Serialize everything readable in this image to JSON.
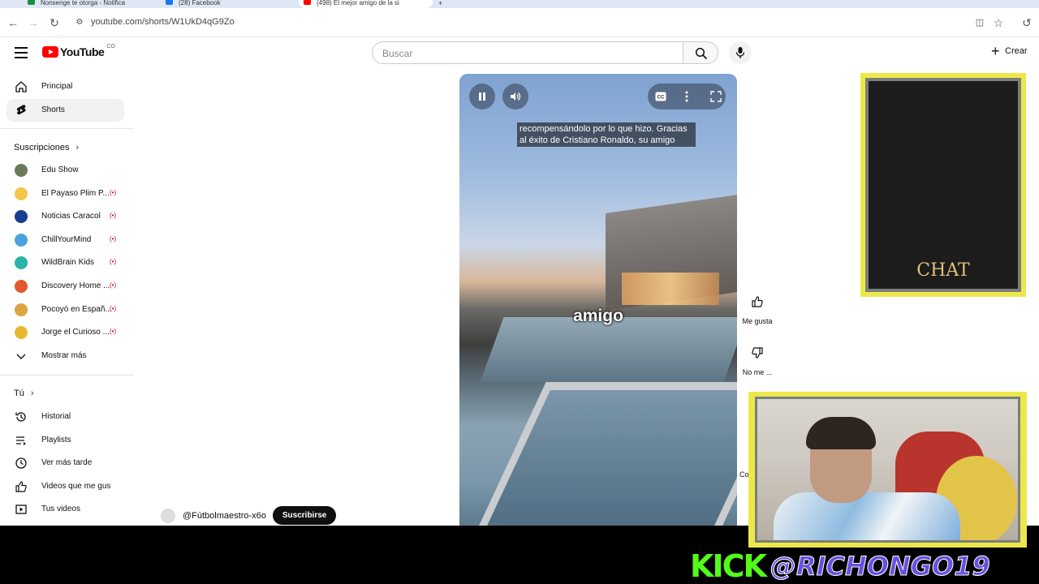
{
  "browser": {
    "tabs": [
      {
        "title": "Nonsenge te otorga - Notifica",
        "favicon_color": "#1e8e3e"
      },
      {
        "title": "(28) Facebook",
        "favicon_color": "#1877f2"
      },
      {
        "title": "(498) El mejor amigo de la si",
        "favicon_color": "#ff0000"
      }
    ],
    "url": "youtube.com/shorts/W1UkD4qG9Zo"
  },
  "header": {
    "logo_text": "YouTube",
    "country_code": "CO",
    "search_placeholder": "Buscar",
    "create_label": "Crear"
  },
  "sidebar": {
    "main": [
      {
        "label": "Principal",
        "icon": "home-icon"
      },
      {
        "label": "Shorts",
        "icon": "shorts-icon"
      }
    ],
    "subscriptions_title": "Suscripciones",
    "subscriptions": [
      {
        "label": "Edu Show",
        "color": "#6b7a5a",
        "live": false
      },
      {
        "label": "El Payaso Plim P...",
        "color": "#f3c64a",
        "live": true
      },
      {
        "label": "Noticias Caracol",
        "color": "#1a3d8f",
        "live": true
      },
      {
        "label": "ChillYourMind",
        "color": "#4aa3df",
        "live": true
      },
      {
        "label": "WildBrain Kids",
        "color": "#2bb3a8",
        "live": true
      },
      {
        "label": "Discovery Home ...",
        "color": "#e2572c",
        "live": true
      },
      {
        "label": "Pocoyó en Españ...",
        "color": "#d9a441",
        "live": true
      },
      {
        "label": "Jorge el Curioso ...",
        "color": "#e8b92e",
        "live": true
      }
    ],
    "show_more": "Mostrar más",
    "you_title": "Tú",
    "you_items": [
      {
        "label": "Historial",
        "icon": "history-icon"
      },
      {
        "label": "Playlists",
        "icon": "playlists-icon"
      },
      {
        "label": "Ver más tarde",
        "icon": "watch-later-icon"
      },
      {
        "label": "Videos que me gus...",
        "icon": "like-icon"
      },
      {
        "label": "Tus videos",
        "icon": "your-videos-icon"
      }
    ]
  },
  "video": {
    "subtitle": "recompensándolo por lo que hizo. Gracias al éxito de Cristiano Ronaldo, su amigo",
    "caption": "amigo",
    "channel": "@Fútbolmaestro-x6o",
    "subscribe_label": "Suscribirse"
  },
  "actions": {
    "like_label": "Me gusta",
    "dislike_label": "No me ...",
    "comments_label": "Com"
  },
  "overlay": {
    "chat_label": "CHAT",
    "kick_logo": "KICK",
    "kick_handle": "@RICHONGO19"
  }
}
